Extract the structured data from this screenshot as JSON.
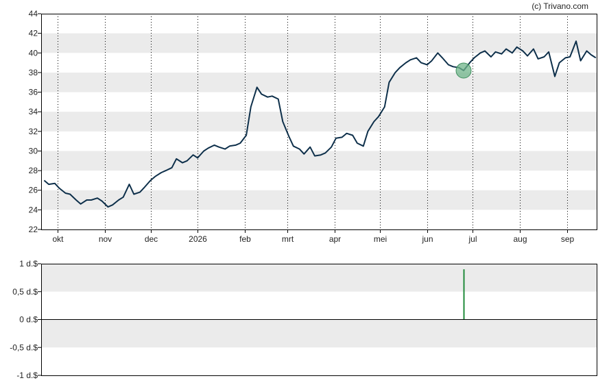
{
  "credit": "(c) Trivano.com",
  "colors": {
    "band": "#ebebeb",
    "line": "#0d2f4a",
    "marker_fill": "#6fb48a",
    "marker_stroke": "#3e8f5e",
    "dividend_bar": "#1f8a3a",
    "axis": "#000000",
    "grid": "#000000"
  },
  "chart_data": [
    {
      "type": "line",
      "title": "",
      "xlabel": "",
      "ylabel": "",
      "ylim": [
        22,
        44
      ],
      "y_ticks": [
        "22",
        "24",
        "26",
        "28",
        "30",
        "32",
        "34",
        "36",
        "38",
        "40",
        "42",
        "44"
      ],
      "x_tick_labels": [
        "okt",
        "nov",
        "dec",
        "2026",
        "feb",
        "mrt",
        "apr",
        "mei",
        "jun",
        "jul",
        "aug",
        "sep"
      ],
      "grid": "vertical dotted at month starts, alternating horizontal bands",
      "highlight": {
        "x": "2026-06-25",
        "y": 38.2,
        "shape": "circle"
      },
      "series": [
        {
          "x": [
            "2025-09-22",
            "2025-09-25",
            "2025-09-29",
            "2025-10-02",
            "2025-10-06",
            "2025-10-09",
            "2025-10-13",
            "2025-10-16",
            "2025-10-20",
            "2025-10-23",
            "2025-10-27",
            "2025-10-30",
            "2025-11-03",
            "2025-11-06",
            "2025-11-10",
            "2025-11-13",
            "2025-11-17",
            "2025-11-20",
            "2025-11-24",
            "2025-11-27",
            "2025-12-01",
            "2025-12-04",
            "2025-12-08",
            "2025-12-11",
            "2025-12-15",
            "2025-12-18",
            "2025-12-22",
            "2025-12-25",
            "2025-12-29",
            "2026-01-01",
            "2026-01-05",
            "2026-01-08",
            "2026-01-12",
            "2026-01-15",
            "2026-01-19",
            "2026-01-22",
            "2026-01-26",
            "2026-01-29",
            "2026-02-02",
            "2026-02-05",
            "2026-02-09",
            "2026-02-12",
            "2026-02-16",
            "2026-02-19",
            "2026-02-23",
            "2026-02-26",
            "2026-03-02",
            "2026-03-05",
            "2026-03-09",
            "2026-03-12",
            "2026-03-16",
            "2026-03-19",
            "2026-03-23",
            "2026-03-26",
            "2026-03-30",
            "2026-04-02",
            "2026-04-06",
            "2026-04-09",
            "2026-04-13",
            "2026-04-16",
            "2026-04-20",
            "2026-04-23",
            "2026-04-27",
            "2026-04-30",
            "2026-05-04",
            "2026-05-07",
            "2026-05-11",
            "2026-05-14",
            "2026-05-18",
            "2026-05-21",
            "2026-05-25",
            "2026-05-28",
            "2026-06-01",
            "2026-06-04",
            "2026-06-08",
            "2026-06-11",
            "2026-06-15",
            "2026-06-18",
            "2026-06-22",
            "2026-06-25",
            "2026-06-29",
            "2026-07-02",
            "2026-07-06",
            "2026-07-09",
            "2026-07-13",
            "2026-07-16",
            "2026-07-20",
            "2026-07-23",
            "2026-07-27",
            "2026-07-30",
            "2026-08-03",
            "2026-08-06",
            "2026-08-10",
            "2026-08-13",
            "2026-08-17",
            "2026-08-20",
            "2026-08-24",
            "2026-08-27",
            "2026-08-31",
            "2026-09-03",
            "2026-09-07",
            "2026-09-10",
            "2026-09-14",
            "2026-09-17",
            "2026-09-20"
          ],
          "values": [
            27.0,
            26.6,
            26.7,
            26.2,
            25.7,
            25.6,
            25.0,
            24.6,
            25.0,
            25.0,
            25.2,
            24.9,
            24.3,
            24.5,
            25.0,
            25.3,
            26.6,
            25.6,
            25.8,
            26.3,
            27.0,
            27.4,
            27.8,
            28.0,
            28.3,
            29.2,
            28.8,
            29.0,
            29.6,
            29.3,
            30.0,
            30.3,
            30.6,
            30.4,
            30.2,
            30.5,
            30.6,
            30.8,
            31.6,
            34.5,
            36.5,
            35.8,
            35.5,
            35.6,
            35.3,
            33.0,
            31.5,
            30.5,
            30.2,
            29.7,
            30.4,
            29.5,
            29.6,
            29.8,
            30.4,
            31.3,
            31.4,
            31.8,
            31.6,
            30.8,
            30.5,
            32.0,
            33.0,
            33.5,
            34.5,
            37.0,
            38.0,
            38.5,
            39.0,
            39.3,
            39.5,
            39.0,
            38.8,
            39.2,
            40.0,
            39.5,
            38.8,
            38.6,
            38.5,
            38.2,
            39.0,
            39.5,
            40.0,
            40.2,
            39.6,
            40.1,
            39.9,
            40.4,
            40.0,
            40.6,
            40.2,
            39.7,
            40.4,
            39.4,
            39.6,
            40.1,
            37.6,
            39.0,
            39.5,
            39.6,
            41.2,
            39.2,
            40.2,
            39.8,
            39.5
          ]
        }
      ]
    },
    {
      "type": "bar",
      "title": "",
      "xlabel": "",
      "ylabel": "",
      "ylim": [
        -1,
        1
      ],
      "y_ticks": [
        "1 d.$",
        "0,5 d.$",
        "0 d.$",
        "-0,5 d.$",
        "-1 d.$"
      ],
      "grid": "alternating horizontal bands",
      "series": [
        {
          "x": [
            "2026-06-25"
          ],
          "values": [
            0.9
          ]
        }
      ]
    }
  ]
}
